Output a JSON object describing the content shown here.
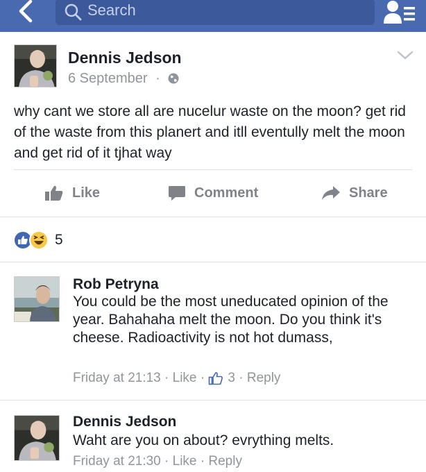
{
  "header": {
    "search_placeholder": "Search"
  },
  "post": {
    "author": "Dennis Jedson",
    "date": "6 September",
    "dot": "·",
    "text": "why cant we store all are nucelur waste on the moon? get rid of the waste from this planert and itll eventully melt the moon and get rid of it tjhat way",
    "actions": {
      "like": "Like",
      "comment": "Comment",
      "share": "Share"
    }
  },
  "reactions": {
    "count": "5"
  },
  "comments": [
    {
      "author": "Rob Petryna",
      "text": "You could be the most uneducated opinion of the year. Bahahaha melt the moon. Do you think it's cheese. Radioactivity is not hot dumass,",
      "time": "Friday at 21:13",
      "like": "Like",
      "likes": "3",
      "reply": "Reply"
    },
    {
      "author": "Dennis Jedson",
      "text": "Waht are you on about? evrything melts.",
      "time": "Friday at 21:30",
      "like": "Like",
      "reply": "Reply"
    }
  ],
  "colors": {
    "header_bg": "#4a6aaf",
    "meta_gray": "#90949c",
    "like_blue": "#4267b2",
    "haha_yellow": "#f7c84a"
  }
}
